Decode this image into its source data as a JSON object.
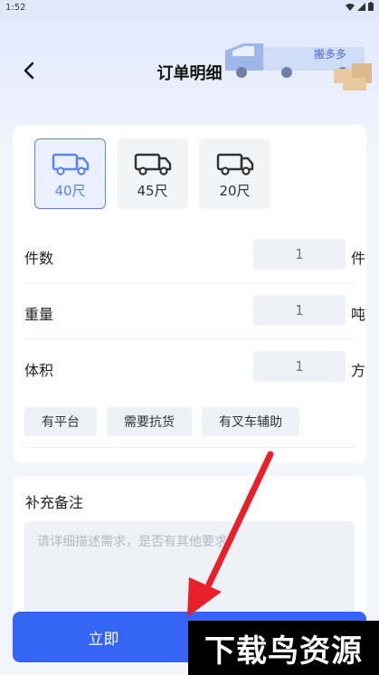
{
  "status_bar": {
    "time": "1:52",
    "icons": [
      "wifi-icon",
      "signal-icon",
      "battery-icon"
    ]
  },
  "header": {
    "title": "订单明细",
    "back_icon": "chevron-left-icon",
    "illustration_brand": "搬多多"
  },
  "vehicles": [
    {
      "label": "40尺",
      "selected": true,
      "icon": "truck-icon"
    },
    {
      "label": "45尺",
      "selected": false,
      "icon": "truck-icon"
    },
    {
      "label": "20尺",
      "selected": false,
      "icon": "truck-icon"
    }
  ],
  "fields": {
    "pieces": {
      "label": "件数",
      "value": "1",
      "unit": "件"
    },
    "weight": {
      "label": "重量",
      "value": "1",
      "unit": "吨"
    },
    "volume": {
      "label": "体积",
      "value": "1",
      "unit": "方"
    }
  },
  "tags": [
    "有平台",
    "需要抗货",
    "有叉车辅助"
  ],
  "notes": {
    "title": "补充备注",
    "placeholder": "请详细描述需求，是否有其他要求"
  },
  "submit": {
    "label": "立即"
  },
  "watermark": {
    "text": "下载鸟资源"
  },
  "colors": {
    "accent": "#3563f3",
    "selected_border": "#5b83f2",
    "selected_bg": "#eaf0ff",
    "input_bg": "#eef1f7",
    "arrow": "#e8202a"
  }
}
